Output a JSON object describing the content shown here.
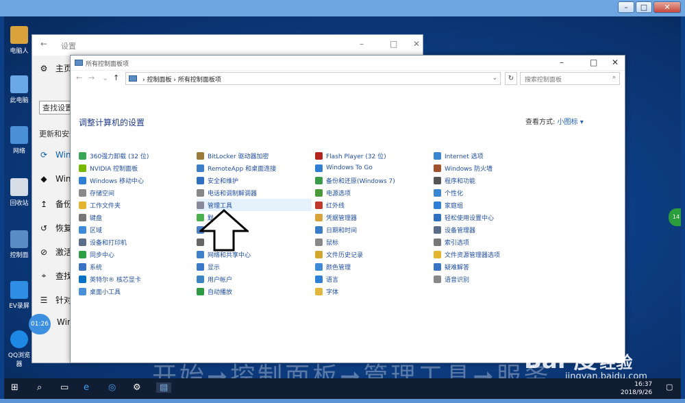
{
  "host": {
    "min": "–",
    "max": "□",
    "close": "✕"
  },
  "desktop_icons": [
    {
      "label": "电脑人"
    },
    {
      "label": "此电脑"
    },
    {
      "label": "网络"
    },
    {
      "label": "回收站"
    },
    {
      "label": "控制面"
    },
    {
      "label": "EV录屏"
    },
    {
      "label": "QQ浏览器"
    }
  ],
  "settings": {
    "title": "设置",
    "search_value": "查找设置",
    "section": "更新和安全",
    "items": [
      {
        "label": "主页",
        "icon": "home-icon"
      },
      {
        "label": "Windo",
        "icon": "sync-icon"
      },
      {
        "label": "Windo",
        "icon": "shield-icon"
      },
      {
        "label": "备份",
        "icon": "backup-icon"
      },
      {
        "label": "恢复",
        "icon": "history-icon"
      },
      {
        "label": "激活",
        "icon": "check-circle-icon"
      },
      {
        "label": "查找我",
        "icon": "find-device-icon"
      },
      {
        "label": "针对开",
        "icon": "developer-icon"
      },
      {
        "label": "Windo",
        "icon": "person-icon"
      }
    ]
  },
  "cp": {
    "title": "所有控制面板项",
    "address": [
      "控制面板",
      "所有控制面板项"
    ],
    "search_placeholder": "搜索控制面板",
    "heading": "调整计算机的设置",
    "viewby_label": "查看方式:",
    "viewby_value": "小图标 ▾",
    "columns": [
      [
        {
          "label": "360强力卸载 (32 位)",
          "color": "#3aa757"
        },
        {
          "label": "NVIDIA 控制面板",
          "color": "#76b900"
        },
        {
          "label": "Windows 移动中心",
          "color": "#2f7fd6"
        },
        {
          "label": "存储空间",
          "color": "#8a8a8a"
        },
        {
          "label": "工作文件夹",
          "color": "#e5b530"
        },
        {
          "label": "键盘",
          "color": "#777777"
        },
        {
          "label": "区域",
          "color": "#3c8ad8"
        },
        {
          "label": "设备和打印机",
          "color": "#5a6e8a"
        },
        {
          "label": "同步中心",
          "color": "#2ea043"
        },
        {
          "label": "系统",
          "color": "#3b73c4"
        },
        {
          "label": "英特尔® 核芯显卡",
          "color": "#0071c5"
        },
        {
          "label": "桌面小工具",
          "color": "#4a90d9"
        }
      ],
      [
        {
          "label": "BitLocker 驱动器加密",
          "color": "#9a7b3a"
        },
        {
          "label": "RemoteApp 和桌面连接",
          "color": "#3c7fc8"
        },
        {
          "label": "安全和维护",
          "color": "#2f6fc0"
        },
        {
          "label": "电话和调制解调器",
          "color": "#888888"
        },
        {
          "label": "管理工具",
          "color": "#8a8a9a",
          "highlight": true
        },
        {
          "label": "默",
          "color": "#4caf50"
        },
        {
          "label": "",
          "color": "#4a7fc8"
        },
        {
          "label": "",
          "color": "#666666"
        },
        {
          "label": "网络和共享中心",
          "color": "#3f7fc9"
        },
        {
          "label": "显示",
          "color": "#3a78c8"
        },
        {
          "label": "用户帐户",
          "color": "#3d86c6"
        },
        {
          "label": "自动播放",
          "color": "#2e9a45"
        }
      ],
      [
        {
          "label": "Flash Player (32 位)",
          "color": "#b3261e"
        },
        {
          "label": "Windows To Go",
          "color": "#2f7fd6"
        },
        {
          "label": "备份和还原(Windows 7)",
          "color": "#3b9a47"
        },
        {
          "label": "电源选项",
          "color": "#4a9a3a"
        },
        {
          "label": "红外线",
          "color": "#c0392b"
        },
        {
          "label": "凭据管理器",
          "color": "#d7a33a"
        },
        {
          "label": "日期和时间",
          "color": "#3b7cc6"
        },
        {
          "label": "鼠标",
          "color": "#888888"
        },
        {
          "label": "文件历史记录",
          "color": "#d4a82f"
        },
        {
          "label": "颜色管理",
          "color": "#3e8ad6"
        },
        {
          "label": "语言",
          "color": "#2f7fd6"
        },
        {
          "label": "字体",
          "color": "#e1b63c"
        }
      ],
      [
        {
          "label": "Internet 选项",
          "color": "#3b86d0"
        },
        {
          "label": "Windows 防火墙",
          "color": "#a0522d"
        },
        {
          "label": "程序和功能",
          "color": "#555555"
        },
        {
          "label": "个性化",
          "color": "#3b86d0"
        },
        {
          "label": "家庭组",
          "color": "#2f7fd6"
        },
        {
          "label": "轻松使用设置中心",
          "color": "#2f6fc0"
        },
        {
          "label": "设备管理器",
          "color": "#5a6e8a"
        },
        {
          "label": "索引选项",
          "color": "#777777"
        },
        {
          "label": "文件资源管理器选项",
          "color": "#e5b530"
        },
        {
          "label": "疑难解答",
          "color": "#3b73c4"
        },
        {
          "label": "语音识别",
          "color": "#888888"
        }
      ]
    ]
  },
  "overlay": {
    "clock_badge": "01:26",
    "side_badge": "14",
    "caption": "开始➞控制面板➞管理工具➞服务",
    "watermark_logo": "Bai 度",
    "watermark_cn": "经验",
    "watermark_url": "jingyan.baidu.com"
  },
  "taskbar": {
    "time": "16:37",
    "date": "2018/9/26",
    "icons": [
      "windows-start-icon",
      "search-icon",
      "task-view-icon",
      "ie-icon",
      "qq-browser-icon",
      "settings-gear-icon",
      "control-panel-icon"
    ]
  },
  "colors": {
    "desktop": "#0d3f86",
    "link": "#1e4d9e",
    "heading": "#1e3a8a",
    "taskbar": "#101d33"
  }
}
